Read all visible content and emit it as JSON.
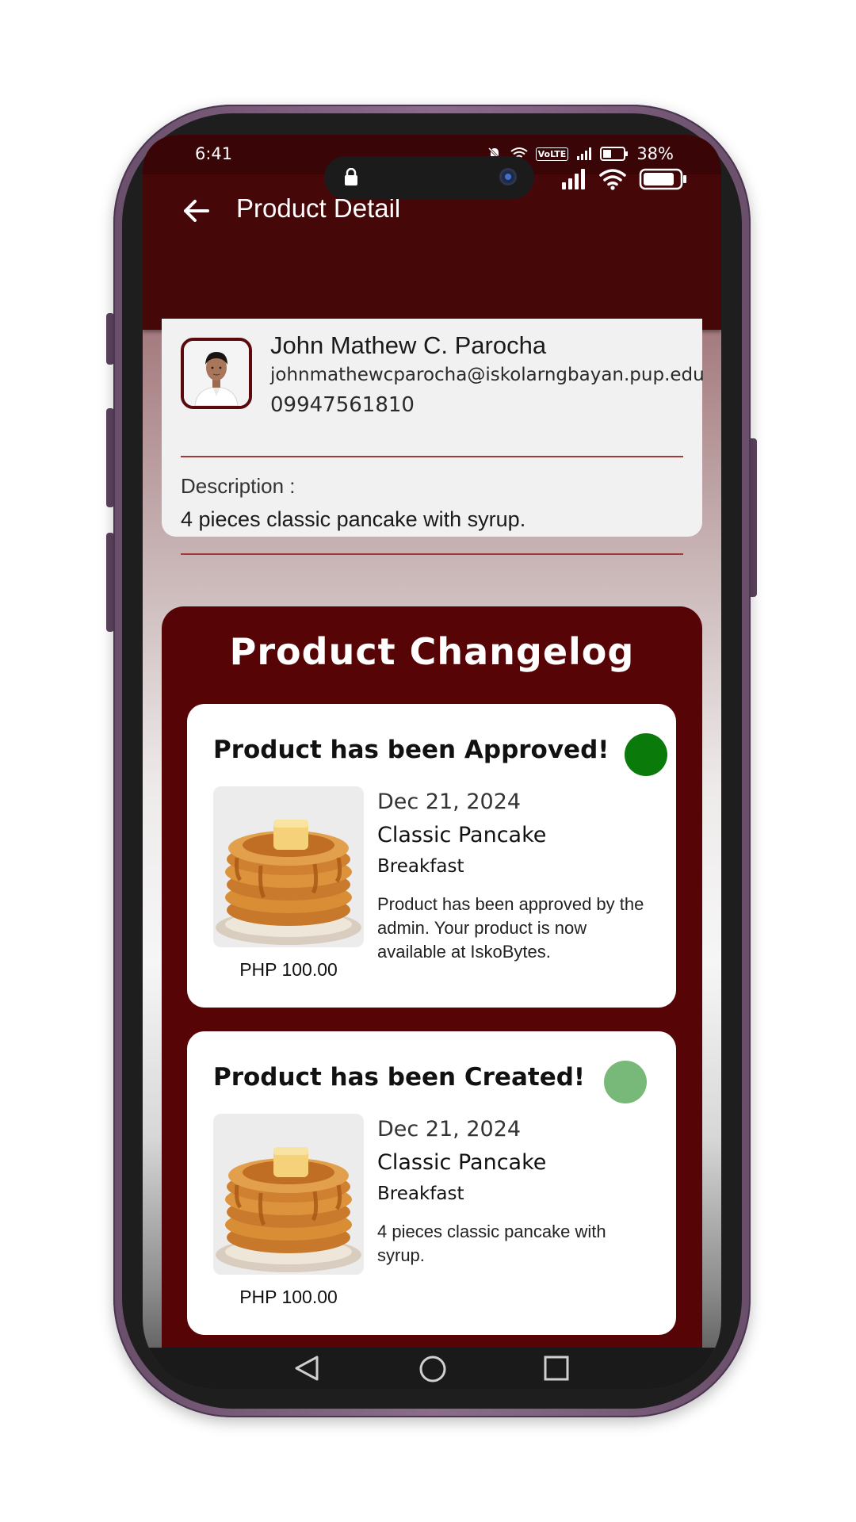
{
  "status_bar": {
    "time": "6:41",
    "volte": "VoLTE",
    "battery": "38%"
  },
  "app_bar": {
    "title": "Product Detail"
  },
  "seller": {
    "name": "John Mathew C. Parocha",
    "email": "johnmathewcparocha@iskolarngbayan.pup.edu",
    "phone": "09947561810"
  },
  "description": {
    "label": "Description :",
    "text": "4 pieces classic pancake with syrup."
  },
  "changelog": {
    "title": "Product Changelog",
    "entries": [
      {
        "heading": "Product has been Approved!",
        "status_color": "#0a7a0a",
        "date": "Dec 21, 2024",
        "product": "Classic Pancake",
        "category": "Breakfast",
        "text": "Product has been approved by the admin. Your product is now available at IskoBytes.",
        "price": "PHP 100.00"
      },
      {
        "heading": "Product has been Created!",
        "status_color": "#78b878",
        "date": "Dec 21, 2024",
        "product": "Classic Pancake",
        "category": "Breakfast",
        "text": "4 pieces classic pancake with syrup.",
        "price": "PHP 100.00"
      }
    ]
  },
  "colors": {
    "app_bar": "#460709",
    "changelog_bg": "#560406",
    "divider": "#a13b3b",
    "phone_frame": "#7a5d7b"
  },
  "icons": {
    "back": "arrow-left-icon",
    "lock": "lock-icon",
    "wifi": "wifi-icon",
    "signal": "signal-icon",
    "battery": "battery-icon",
    "nav_back": "triangle-back-icon",
    "nav_home": "circle-home-icon",
    "nav_recents": "square-recents-icon"
  }
}
